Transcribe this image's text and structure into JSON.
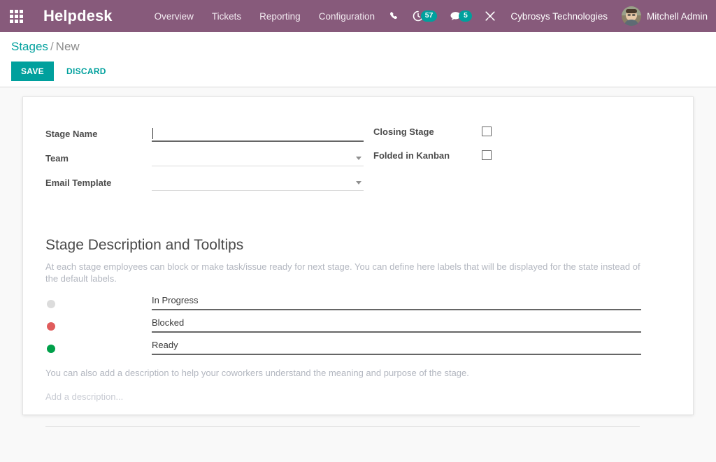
{
  "navbar": {
    "apps_icon": "apps-grid-icon",
    "brand": "Helpdesk",
    "menu": [
      {
        "label": "Overview"
      },
      {
        "label": "Tickets"
      },
      {
        "label": "Reporting"
      },
      {
        "label": "Configuration"
      }
    ],
    "sys_icons": [
      {
        "name": "phone-icon",
        "badge": null
      },
      {
        "name": "activity-clock-icon",
        "badge": "57"
      },
      {
        "name": "messages-icon",
        "badge": "5"
      },
      {
        "name": "tools-icon",
        "badge": null
      }
    ],
    "company": "Cybrosys Technologies",
    "username": "Mitchell Admin",
    "bg_color": "#875a7b",
    "badge_color": "#00a09d"
  },
  "control_panel": {
    "breadcrumb": {
      "parent": "Stages",
      "separator": "/",
      "current": "New"
    },
    "save_label": "SAVE",
    "discard_label": "DISCARD",
    "accent_color": "#00a09d"
  },
  "form": {
    "fields": [
      {
        "label": "Stage Name",
        "value": "",
        "placeholder": "",
        "type": "text",
        "focused": true
      },
      {
        "label": "Team",
        "value": "",
        "placeholder": "",
        "type": "select"
      },
      {
        "label": "Email Template",
        "value": "",
        "placeholder": "",
        "type": "select"
      }
    ],
    "checkboxes": [
      {
        "label": "Closing Stage",
        "checked": false
      },
      {
        "label": "Folded in Kanban",
        "checked": false
      }
    ]
  },
  "description_section": {
    "title": "Stage Description and Tooltips",
    "help_text": "At each stage employees can block or make task/issue ready for next stage. You can define here labels that will be displayed for the state instead of the default labels.",
    "legend_rows": [
      {
        "state": "normal",
        "dot_color": "#dcdcdc",
        "value": "In Progress"
      },
      {
        "state": "blocked",
        "dot_color": "#e05c5c",
        "value": "Blocked"
      },
      {
        "state": "ready",
        "dot_color": "#00a04a",
        "value": "Ready"
      }
    ],
    "description_help": "You can also add a description to help your coworkers understand the meaning and purpose of the stage.",
    "description_placeholder": "Add a description...",
    "description_value": ""
  }
}
